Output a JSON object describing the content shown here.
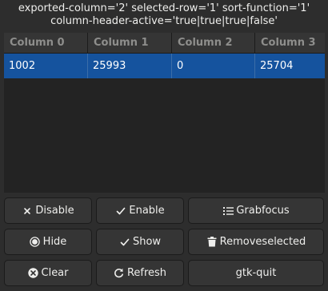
{
  "status": {
    "line1": "exported-column='2' selected-row='1' sort-function='1'",
    "line2": "column-header-active='true|true|true|false'"
  },
  "table": {
    "columns": [
      "Column 0",
      "Column 1",
      "Column 2",
      "Column 3"
    ],
    "rows": [
      [
        "1002",
        "25993",
        "0",
        "25704"
      ]
    ],
    "selected_row_color": "#15539e"
  },
  "buttons": {
    "disable": {
      "label": "Disable",
      "icon": "x-icon"
    },
    "enable": {
      "label": "Enable",
      "icon": "check-icon"
    },
    "grabfocus": {
      "label": "Grabfocus",
      "icon": "list-icon"
    },
    "hide": {
      "label": "Hide",
      "icon": "radio-icon"
    },
    "show": {
      "label": "Show",
      "icon": "check-icon"
    },
    "removeselected": {
      "label": "Removeselected",
      "icon": "trash-icon"
    },
    "clear": {
      "label": "Clear",
      "icon": "clear-circle-icon"
    },
    "refresh": {
      "label": "Refresh",
      "icon": "refresh-icon"
    },
    "gtk_quit": {
      "label": "gtk-quit"
    }
  }
}
